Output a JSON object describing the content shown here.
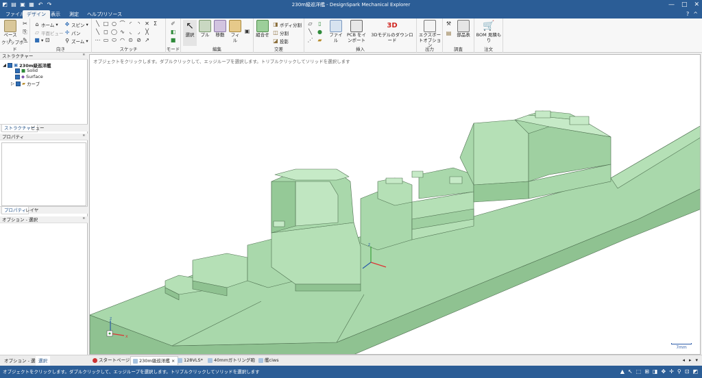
{
  "app": {
    "title": "230m級巡洋艦 - DesignSpark Mechanical Explorer",
    "quick_access_icons": [
      "app-icon",
      "new-icon",
      "open-icon",
      "save-icon",
      "undo-icon",
      "redo-icon"
    ],
    "window_buttons": [
      "—",
      "□",
      "✕"
    ]
  },
  "menu": {
    "tabs": [
      "ファイル",
      "デザイン",
      "表示",
      "測定",
      "ヘルプ/リソース"
    ],
    "active": "デザイン"
  },
  "ribbon": {
    "clipboard": {
      "label": "クリップボード",
      "paste": "ペースト"
    },
    "orient": {
      "label": "向き",
      "home": "ホーム",
      "plane": "平面ビュー",
      "spin": "スピン",
      "pan": "パン",
      "zoom": "ズーム"
    },
    "sketch": {
      "label": "スケッチ"
    },
    "mode": {
      "label": "モード"
    },
    "edit": {
      "label": "編集",
      "select": "選択",
      "pull": "プル",
      "move": "移動",
      "fill": "フィル"
    },
    "intersect": {
      "label": "交差",
      "combine": "組合せ",
      "split_body": "ボディ分割",
      "split": "分割",
      "project": "投影"
    },
    "insert": {
      "label": "挿入",
      "file": "ファイル",
      "pcb": "PCB をインポート",
      "download3d": "3Dモデルのダウンロード"
    },
    "output": {
      "label": "出力",
      "export": "エクスポートオプション"
    },
    "investigate": {
      "label": "調査",
      "parts_table": "部品表"
    },
    "order": {
      "label": "注文",
      "bom": "BOM 見積もり"
    }
  },
  "structure": {
    "header": "ストラクチャー",
    "root": "230m級巡洋艦",
    "items": [
      "Solid",
      "Surface",
      "カーブ"
    ],
    "tabs": [
      "ストラクチャー",
      "ビュー"
    ]
  },
  "properties": {
    "header": "プロパティ",
    "tabs": [
      "プロパティ",
      "レイヤ"
    ]
  },
  "options": {
    "header": "オプション - 選択"
  },
  "viewport": {
    "hint": "オブジェクトをクリックします。ダブルクリックして、エッジループを選択します。トリプルクリックしてソリッドを選択します",
    "scale_label": "7mm",
    "axes": [
      "x",
      "y",
      "z"
    ],
    "hull_color": "#a9d8ab"
  },
  "doc_tabs": {
    "bottom_left": [
      "オプション - 選択",
      "選択"
    ],
    "items": [
      "スタートページ",
      "230m級巡洋艦",
      "128VLS*",
      "40mmガトリング砲",
      "艦ciws"
    ],
    "active": "230m級巡洋艦",
    "nav": [
      "◂",
      "▸",
      "▾"
    ]
  },
  "status": {
    "message": "オブジェクトをクリックします。ダブルクリックして、エッジループを選択します。トリプルクリックしてソリッドを選択します"
  }
}
